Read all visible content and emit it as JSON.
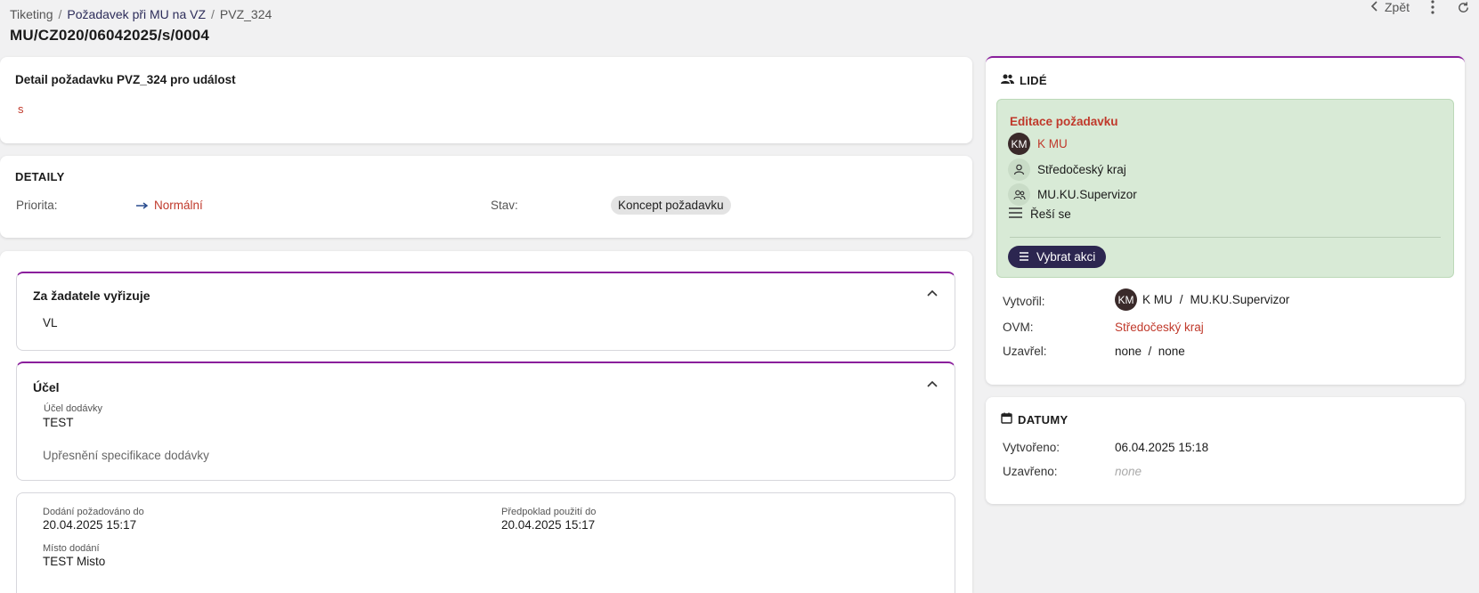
{
  "breadcrumb": {
    "root": "Tiketing",
    "mid": "Požadavek při MU na VZ",
    "current": "PVZ_324"
  },
  "page_title": "MU/CZ020/06042025/s/0004",
  "top_actions": {
    "back_label": "Zpět",
    "more_icon": "more-vertical-icon",
    "refresh_icon": "refresh-icon"
  },
  "detail_card": {
    "title": "Detail požadavku PVZ_324 pro událost",
    "value": "s"
  },
  "details": {
    "title": "DETAILY",
    "priority_label": "Priorita:",
    "priority_value": "Normální",
    "state_label": "Stav:",
    "state_value": "Koncept požadavku"
  },
  "zadatel": {
    "title": "Za žadatele vyřizuje",
    "value": "VL"
  },
  "ucel": {
    "title": "Účel",
    "field_label": "Účel dodávky",
    "field_value": "TEST",
    "spec_placeholder": "Upřesnění specifikace dodávky"
  },
  "dates_panel": {
    "delivery_label": "Dodání požadováno do",
    "delivery_value": "20.04.2025 15:17",
    "use_label": "Předpoklad použití do",
    "use_value": "20.04.2025 15:17",
    "place_label": "Místo dodání",
    "place_value": "TEST Misto"
  },
  "lide": {
    "title": "LIDÉ",
    "edit": {
      "title": "Editace požadavku",
      "avatar_initials": "KM",
      "user": "K MU",
      "region": "Středočeský kraj",
      "role": "MU.KU.Supervizor",
      "status": "Řeší se",
      "action_button": "Vybrat akci"
    },
    "created_label": "Vytvořil:",
    "created_avatar": "KM",
    "created_user": "K MU",
    "created_sep": "/",
    "created_role": "MU.KU.Supervizor",
    "ovm_label": "OVM:",
    "ovm_value": "Středočeský kraj",
    "closed_label": "Uzavřel:",
    "closed_value": "none  /  none"
  },
  "datumy": {
    "title": "DATUMY",
    "created_label": "Vytvořeno:",
    "created_value": "06.04.2025 15:18",
    "closed_label": "Uzavřeno:",
    "closed_value": "none"
  },
  "colors": {
    "accent": "#8a1f9c",
    "link_red": "#c0392b",
    "button_dark": "#2c2650",
    "green_bg": "#d8ead6"
  }
}
